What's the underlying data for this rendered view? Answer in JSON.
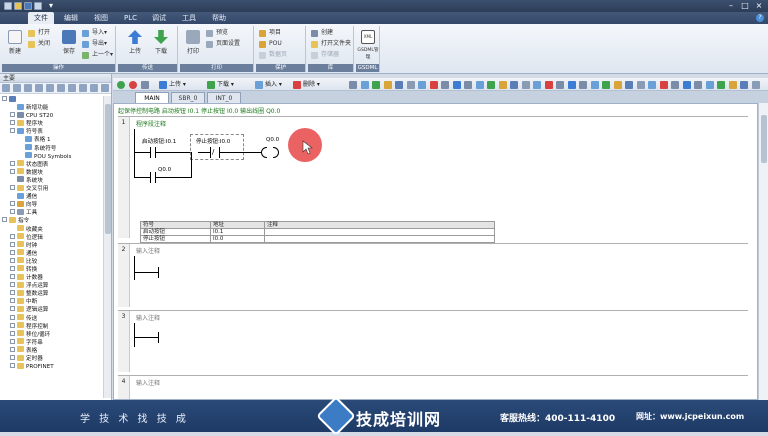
{
  "titlebar": {
    "quick_access": [
      "new",
      "open",
      "save",
      "print",
      "dropdown"
    ]
  },
  "menubar": {
    "items": [
      "文件",
      "编辑",
      "视图",
      "PLC",
      "调试",
      "工具",
      "帮助"
    ],
    "active": "文件",
    "help_glyph": "?"
  },
  "ribbon": {
    "groups": [
      {
        "label": "操作",
        "big": [
          {
            "label": "新建"
          },
          {
            "label": "保存"
          }
        ],
        "small": [
          "打开",
          "关闭",
          "导入▾",
          "导出▾",
          "上一个▾"
        ]
      },
      {
        "label": "传送",
        "big": [
          {
            "label": "上传"
          },
          {
            "label": "下载"
          }
        ]
      },
      {
        "label": "打印",
        "big": [
          {
            "label": "打印"
          }
        ],
        "small": [
          "预览",
          "页面设置"
        ]
      },
      {
        "label": "保护",
        "small": [
          "项目",
          "POU",
          "数据页"
        ]
      },
      {
        "label": "库",
        "small": [
          "创建",
          "打开文件夹",
          "存储器"
        ]
      },
      {
        "label": "GSDML",
        "big": [
          {
            "label": "GSDML管理"
          }
        ]
      }
    ]
  },
  "left_panel": {
    "title": "主要",
    "tree": [
      {
        "level": 0,
        "exp": "-",
        "label": "",
        "icon": "project"
      },
      {
        "level": 1,
        "exp": "",
        "label": "新增功能",
        "icon": "new"
      },
      {
        "level": 1,
        "exp": "+",
        "label": "CPU ST20",
        "icon": "cpu"
      },
      {
        "level": 1,
        "exp": "+",
        "label": "程序块",
        "icon": "folder"
      },
      {
        "level": 1,
        "exp": "-",
        "label": "符号表",
        "icon": "table"
      },
      {
        "level": 2,
        "exp": "",
        "label": "表格 1",
        "icon": "table"
      },
      {
        "level": 2,
        "exp": "",
        "label": "系统符号",
        "icon": "table"
      },
      {
        "level": 2,
        "exp": "",
        "label": "POU Symbols",
        "icon": "table"
      },
      {
        "level": 1,
        "exp": "+",
        "label": "状态图表",
        "icon": "folder"
      },
      {
        "level": 1,
        "exp": "+",
        "label": "数据块",
        "icon": "folder"
      },
      {
        "level": 1,
        "exp": "",
        "label": "系统块",
        "icon": "block"
      },
      {
        "level": 1,
        "exp": "+",
        "label": "交叉引用",
        "icon": "folder"
      },
      {
        "level": 1,
        "exp": "",
        "label": "通信",
        "icon": "comm"
      },
      {
        "level": 1,
        "exp": "+",
        "label": "向导",
        "icon": "wizard"
      },
      {
        "level": 1,
        "exp": "+",
        "label": "工具",
        "icon": "tool"
      },
      {
        "level": 0,
        "exp": "-",
        "label": "指令",
        "icon": "folder"
      },
      {
        "level": 1,
        "exp": "",
        "label": "收藏夹",
        "icon": "star"
      },
      {
        "level": 1,
        "exp": "+",
        "label": "位逻辑",
        "icon": "folder"
      },
      {
        "level": 1,
        "exp": "+",
        "label": "时钟",
        "icon": "folder"
      },
      {
        "level": 1,
        "exp": "+",
        "label": "通信",
        "icon": "folder"
      },
      {
        "level": 1,
        "exp": "+",
        "label": "比较",
        "icon": "folder"
      },
      {
        "level": 1,
        "exp": "+",
        "label": "转换",
        "icon": "folder"
      },
      {
        "level": 1,
        "exp": "+",
        "label": "计数器",
        "icon": "folder"
      },
      {
        "level": 1,
        "exp": "+",
        "label": "浮点运算",
        "icon": "folder"
      },
      {
        "level": 1,
        "exp": "+",
        "label": "整数运算",
        "icon": "folder"
      },
      {
        "level": 1,
        "exp": "+",
        "label": "中断",
        "icon": "folder"
      },
      {
        "level": 1,
        "exp": "+",
        "label": "逻辑运算",
        "icon": "folder"
      },
      {
        "level": 1,
        "exp": "+",
        "label": "传送",
        "icon": "folder"
      },
      {
        "level": 1,
        "exp": "+",
        "label": "程序控制",
        "icon": "folder"
      },
      {
        "level": 1,
        "exp": "+",
        "label": "移位/循环",
        "icon": "folder"
      },
      {
        "level": 1,
        "exp": "+",
        "label": "字符串",
        "icon": "folder"
      },
      {
        "level": 1,
        "exp": "+",
        "label": "表格",
        "icon": "folder"
      },
      {
        "level": 1,
        "exp": "+",
        "label": "定时器",
        "icon": "folder"
      },
      {
        "level": 1,
        "exp": "+",
        "label": "PROFINET",
        "icon": "folder"
      }
    ]
  },
  "editor_toolbar": {
    "items": [
      "上传 ▾",
      "下载 ▾",
      "插入 ▾",
      "删除 ▾"
    ]
  },
  "tabs": [
    "MAIN",
    "SBR_0",
    "INT_0"
  ],
  "tabs_active": "MAIN",
  "program": {
    "header_comment": "起保停控制电路  启动按钮 I0.1  停止按钮 I0.0  输出线圈 Q0.0",
    "networks": [
      {
        "number": "1",
        "comment": "程序段注释",
        "contact1": "启动按钮:I0.1",
        "contact2": "停止按钮:I0.0",
        "coil": "Q0.0",
        "branch": "Q0.0",
        "nc_glyph": "/",
        "symtable": {
          "headers": [
            "符号",
            "地址",
            "注释"
          ],
          "rows": [
            [
              "启动按钮",
              "I0.1",
              ""
            ],
            [
              "停止按钮",
              "I0.0",
              ""
            ]
          ]
        }
      },
      {
        "number": "2",
        "comment": "输入注释"
      },
      {
        "number": "3",
        "comment": "输入注释"
      },
      {
        "number": "4",
        "comment": "输入注释"
      }
    ]
  },
  "banner": {
    "slogan": "学 技 术   找 技 成",
    "brand": "技成培训网",
    "hotline": "客服热线：400-111-4100",
    "website": "网址：www.jcpeixun.com"
  },
  "colors": {
    "accent": "#2c3d57",
    "comment_green": "#1a7a1a",
    "cursor_red": "#e84646"
  }
}
